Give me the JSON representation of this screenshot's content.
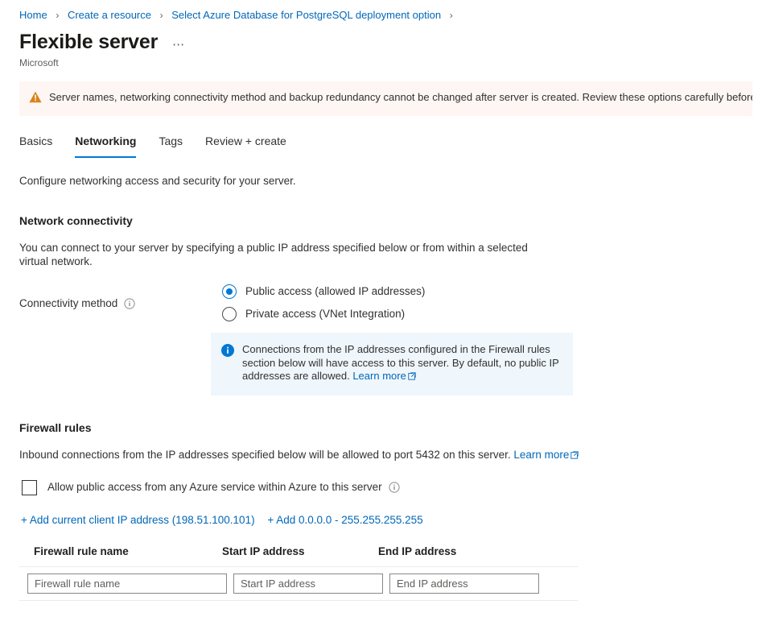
{
  "breadcrumb": {
    "items": [
      {
        "label": "Home"
      },
      {
        "label": "Create a resource"
      },
      {
        "label": "Select Azure Database for PostgreSQL deployment option"
      }
    ],
    "separator": "›"
  },
  "header": {
    "title": "Flexible server",
    "ellipsis": "⋯",
    "publisher": "Microsoft"
  },
  "warning": {
    "icon": "warning-triangle-icon",
    "text": "Server names, networking connectivity method and backup redundancy cannot be changed after server is created. Review these options carefully before provisioning",
    "background": "#fdf6f3",
    "icon_color": "#d8831a"
  },
  "tabs": [
    {
      "label": "Basics",
      "selected": false
    },
    {
      "label": "Networking",
      "selected": true
    },
    {
      "label": "Tags",
      "selected": false
    },
    {
      "label": "Review + create",
      "selected": false
    }
  ],
  "subtitle": "Configure networking access and security for your server.",
  "network_connectivity": {
    "heading": "Network connectivity",
    "description": "You can connect to your server by specifying a public IP address specified below or from within a selected virtual network.",
    "connectivity_method": {
      "label": "Connectivity method",
      "info_icon": "info-circle-icon",
      "options": [
        {
          "label": "Public access (allowed IP addresses)",
          "selected": true
        },
        {
          "label": "Private access (VNet Integration)",
          "selected": false
        }
      ]
    },
    "info_box": {
      "icon": "info-filled-icon",
      "text": "Connections from the IP addresses configured in the Firewall rules section below will have access to this server. By default, no public IP addresses are allowed.",
      "link_label": "Learn more",
      "background": "#eff6fc"
    }
  },
  "firewall_rules": {
    "heading": "Firewall rules",
    "description": "Inbound connections from the IP addresses specified below will be allowed to port 5432 on this server.",
    "description_link": "Learn more",
    "allow_azure_checkbox": {
      "label": "Allow public access from any Azure service within Azure to this server",
      "checked": false,
      "info_icon": "info-circle-icon"
    },
    "add_links": [
      {
        "label": "+ Add current client IP address (198.51.100.101)"
      },
      {
        "label": "+ Add 0.0.0.0 - 255.255.255.255"
      }
    ],
    "table": {
      "columns": [
        "Firewall rule name",
        "Start IP address",
        "End IP address"
      ],
      "rows": [
        {
          "rule_name": {
            "value": "",
            "placeholder": "Firewall rule name"
          },
          "start_ip": {
            "value": "",
            "placeholder": "Start IP address"
          },
          "end_ip": {
            "value": "",
            "placeholder": "End IP address"
          }
        }
      ]
    }
  },
  "colors": {
    "accent": "#0078d4",
    "link": "#0067b8",
    "warning": "#d8831a",
    "text": "#323130"
  }
}
